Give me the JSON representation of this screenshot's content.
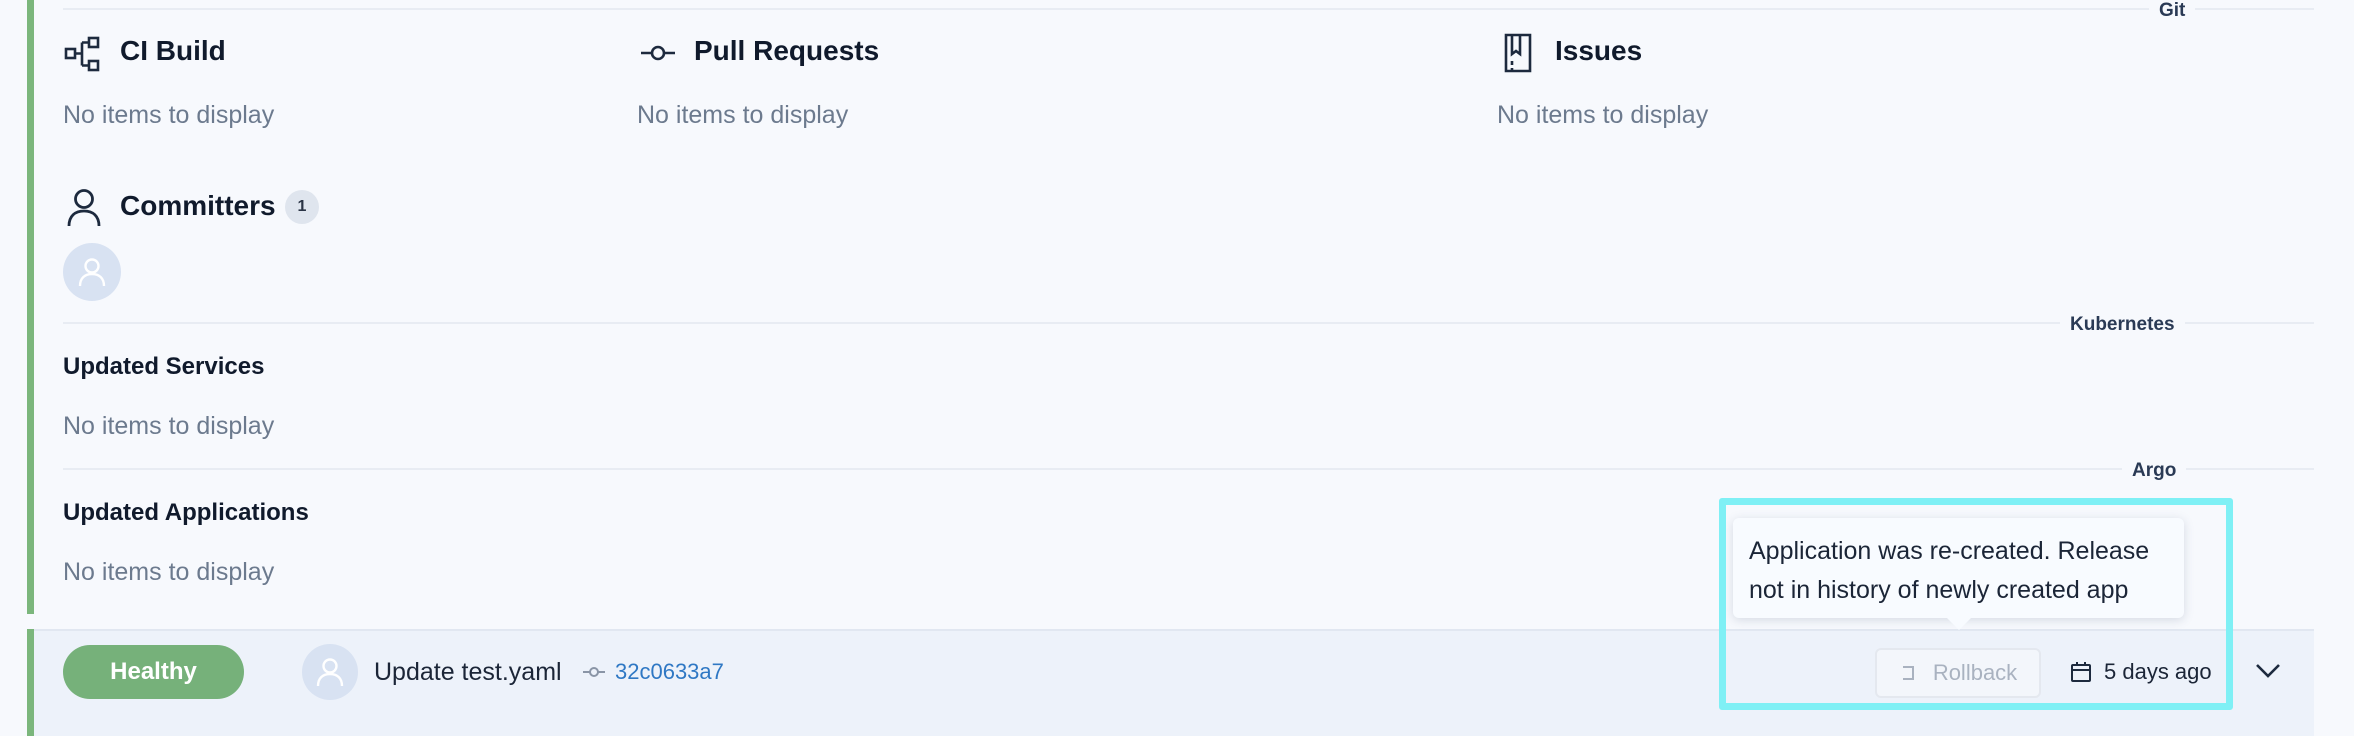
{
  "sections": {
    "git": "Git",
    "kubernetes": "Kubernetes",
    "argo": "Argo"
  },
  "ci_build": {
    "title": "CI Build",
    "empty": "No items to display"
  },
  "pull_requests": {
    "title": "Pull Requests",
    "empty": "No items to display"
  },
  "issues": {
    "title": "Issues",
    "empty": "No items to display"
  },
  "committers": {
    "title": "Committers",
    "count": "1"
  },
  "updated_services": {
    "title": "Updated Services",
    "empty": "No items to display"
  },
  "updated_applications": {
    "title": "Updated Applications",
    "empty": "No items to display"
  },
  "release_row": {
    "status": "Healthy",
    "commit_message": "Update test.yaml",
    "commit_hash": "32c0633a7",
    "rollback_label": "Rollback",
    "time": "5 days ago"
  },
  "tooltip": {
    "line1": "Application was re-created. Release",
    "line2": "not in history of newly created app"
  },
  "colors": {
    "healthy": "#76b17a",
    "accent_bar": "#7bb67c",
    "link": "#2f78c4",
    "highlight": "#7ff0f5"
  },
  "icons": [
    "ci-build-icon",
    "commit-icon",
    "issues-icon",
    "user-icon",
    "calendar-icon",
    "rollback-icon",
    "chevron-down-icon"
  ]
}
